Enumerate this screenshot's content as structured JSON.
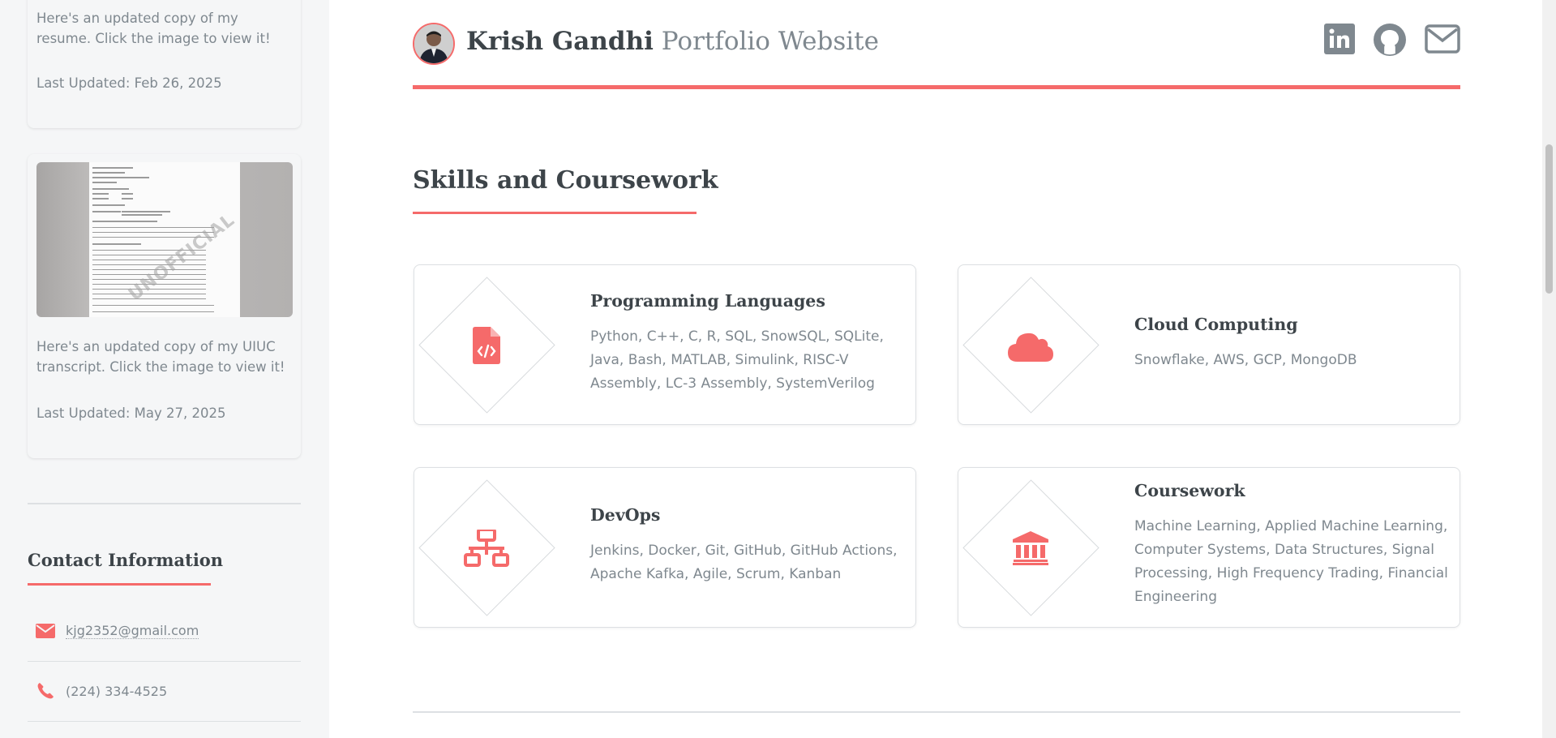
{
  "sidebar": {
    "resume_card": {
      "text": "Here's an updated copy of my resume. Click the image to view it!",
      "updated": "Last Updated: Feb 26, 2025"
    },
    "transcript_card": {
      "text": "Here's an updated copy of my UIUC transcript. Click the image to view it!",
      "updated": "Last Updated: May 27, 2025",
      "watermark": "UNOFFICIAL"
    },
    "contact": {
      "title": "Contact Information",
      "email": "kjg2352@gmail.com",
      "phone": "(224) 334-4525"
    }
  },
  "header": {
    "name": "Krish Gandhi",
    "subtitle": "Portfolio Website",
    "social": [
      "linkedin-icon",
      "github-icon",
      "envelope-icon"
    ]
  },
  "section": {
    "title": "Skills and Coursework",
    "features": [
      {
        "title": "Programming Languages",
        "desc": "Python, C++, C, R, SQL, SnowSQL, SQLite, Java, Bash, MATLAB, Simulink, RISC-V Assembly, LC-3 Assembly, SystemVerilog",
        "icon": "file-code-icon"
      },
      {
        "title": "Cloud Computing",
        "desc": "Snowflake, AWS, GCP, MongoDB",
        "icon": "cloud-icon"
      },
      {
        "title": "DevOps",
        "desc": "Jenkins, Docker, Git, GitHub, GitHub Actions, Apache Kafka, Agile, Scrum, Kanban",
        "icon": "sitemap-icon"
      },
      {
        "title": "Coursework",
        "desc": "Machine Learning, Applied Machine Learning, Computer Systems, Data Structures, Signal Processing, High Frequency Trading, Financial Engineering",
        "icon": "university-icon"
      }
    ]
  },
  "colors": {
    "accent": "#f56a6a",
    "text": "#3d4449",
    "muted": "#7f888f",
    "sidebar_bg": "#f5f6f7"
  }
}
